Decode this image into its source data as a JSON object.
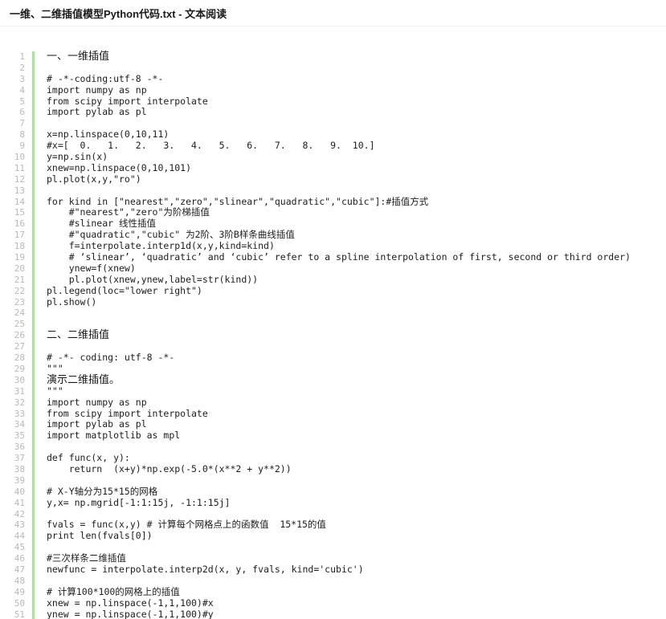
{
  "window": {
    "title": "一维、二维插值模型Python代码.txt - 文本阅读"
  },
  "document": {
    "filename": "一维、二维插值模型Python代码.txt",
    "viewer_label": "文本阅读",
    "lines": [
      {
        "n": "1",
        "text": "一、一维插值",
        "heading": true
      },
      {
        "n": "2",
        "text": ""
      },
      {
        "n": "3",
        "text": "# -*-coding:utf-8 -*-"
      },
      {
        "n": "4",
        "text": "import numpy as np"
      },
      {
        "n": "5",
        "text": "from scipy import interpolate"
      },
      {
        "n": "6",
        "text": "import pylab as pl"
      },
      {
        "n": "7",
        "text": ""
      },
      {
        "n": "8",
        "text": "x=np.linspace(0,10,11)"
      },
      {
        "n": "9",
        "text": "#x=[  0.   1.   2.   3.   4.   5.   6.   7.   8.   9.  10.]"
      },
      {
        "n": "10",
        "text": "y=np.sin(x)"
      },
      {
        "n": "11",
        "text": "xnew=np.linspace(0,10,101)"
      },
      {
        "n": "12",
        "text": "pl.plot(x,y,\"ro\")"
      },
      {
        "n": "13",
        "text": ""
      },
      {
        "n": "14",
        "text": "for kind in [\"nearest\",\"zero\",\"slinear\",\"quadratic\",\"cubic\"]:#插值方式"
      },
      {
        "n": "15",
        "text": "    #\"nearest\",\"zero\"为阶梯插值"
      },
      {
        "n": "16",
        "text": "    #slinear 线性插值"
      },
      {
        "n": "17",
        "text": "    #\"quadratic\",\"cubic\" 为2阶、3阶B样条曲线插值"
      },
      {
        "n": "18",
        "text": "    f=interpolate.interp1d(x,y,kind=kind)"
      },
      {
        "n": "19",
        "text": "    # ‘slinear’, ‘quadratic’ and ‘cubic’ refer to a spline interpolation of first, second or third order)"
      },
      {
        "n": "20",
        "text": "    ynew=f(xnew)"
      },
      {
        "n": "21",
        "text": "    pl.plot(xnew,ynew,label=str(kind))"
      },
      {
        "n": "22",
        "text": "pl.legend(loc=\"lower right\")"
      },
      {
        "n": "23",
        "text": "pl.show()"
      },
      {
        "n": "24",
        "text": ""
      },
      {
        "n": "25",
        "text": ""
      },
      {
        "n": "26",
        "text": "二、二维插值",
        "heading": true
      },
      {
        "n": "27",
        "text": ""
      },
      {
        "n": "28",
        "text": "# -*- coding: utf-8 -*-"
      },
      {
        "n": "29",
        "text": "\"\"\""
      },
      {
        "n": "30",
        "text": "演示二维插值。",
        "heading": true
      },
      {
        "n": "31",
        "text": "\"\"\""
      },
      {
        "n": "32",
        "text": "import numpy as np"
      },
      {
        "n": "33",
        "text": "from scipy import interpolate"
      },
      {
        "n": "34",
        "text": "import pylab as pl"
      },
      {
        "n": "35",
        "text": "import matplotlib as mpl"
      },
      {
        "n": "36",
        "text": ""
      },
      {
        "n": "37",
        "text": "def func(x, y):"
      },
      {
        "n": "38",
        "text": "    return  (x+y)*np.exp(-5.0*(x**2 + y**2))"
      },
      {
        "n": "39",
        "text": ""
      },
      {
        "n": "40",
        "text": "# X-Y轴分为15*15的网格"
      },
      {
        "n": "41",
        "text": "y,x= np.mgrid[-1:1:15j, -1:1:15j]"
      },
      {
        "n": "42",
        "text": ""
      },
      {
        "n": "43",
        "text": "fvals = func(x,y) # 计算每个网格点上的函数值  15*15的值"
      },
      {
        "n": "44",
        "text": "print len(fvals[0])"
      },
      {
        "n": "45",
        "text": ""
      },
      {
        "n": "46",
        "text": "#三次样条二维插值"
      },
      {
        "n": "47",
        "text": "newfunc = interpolate.interp2d(x, y, fvals, kind='cubic')"
      },
      {
        "n": "48",
        "text": ""
      },
      {
        "n": "49",
        "text": "# 计算100*100的网格上的插值"
      },
      {
        "n": "50",
        "text": "xnew = np.linspace(-1,1,100)#x"
      },
      {
        "n": "51",
        "text": "ynew = np.linspace(-1,1,100)#y"
      }
    ]
  },
  "colors": {
    "background": "#ffffff",
    "text": "#1c1c1c",
    "gutter_text": "#b9b9b9",
    "gutter_separator": "#aee0a3",
    "header_border": "#f2f2f2",
    "title_text": "#1a1a1a"
  }
}
